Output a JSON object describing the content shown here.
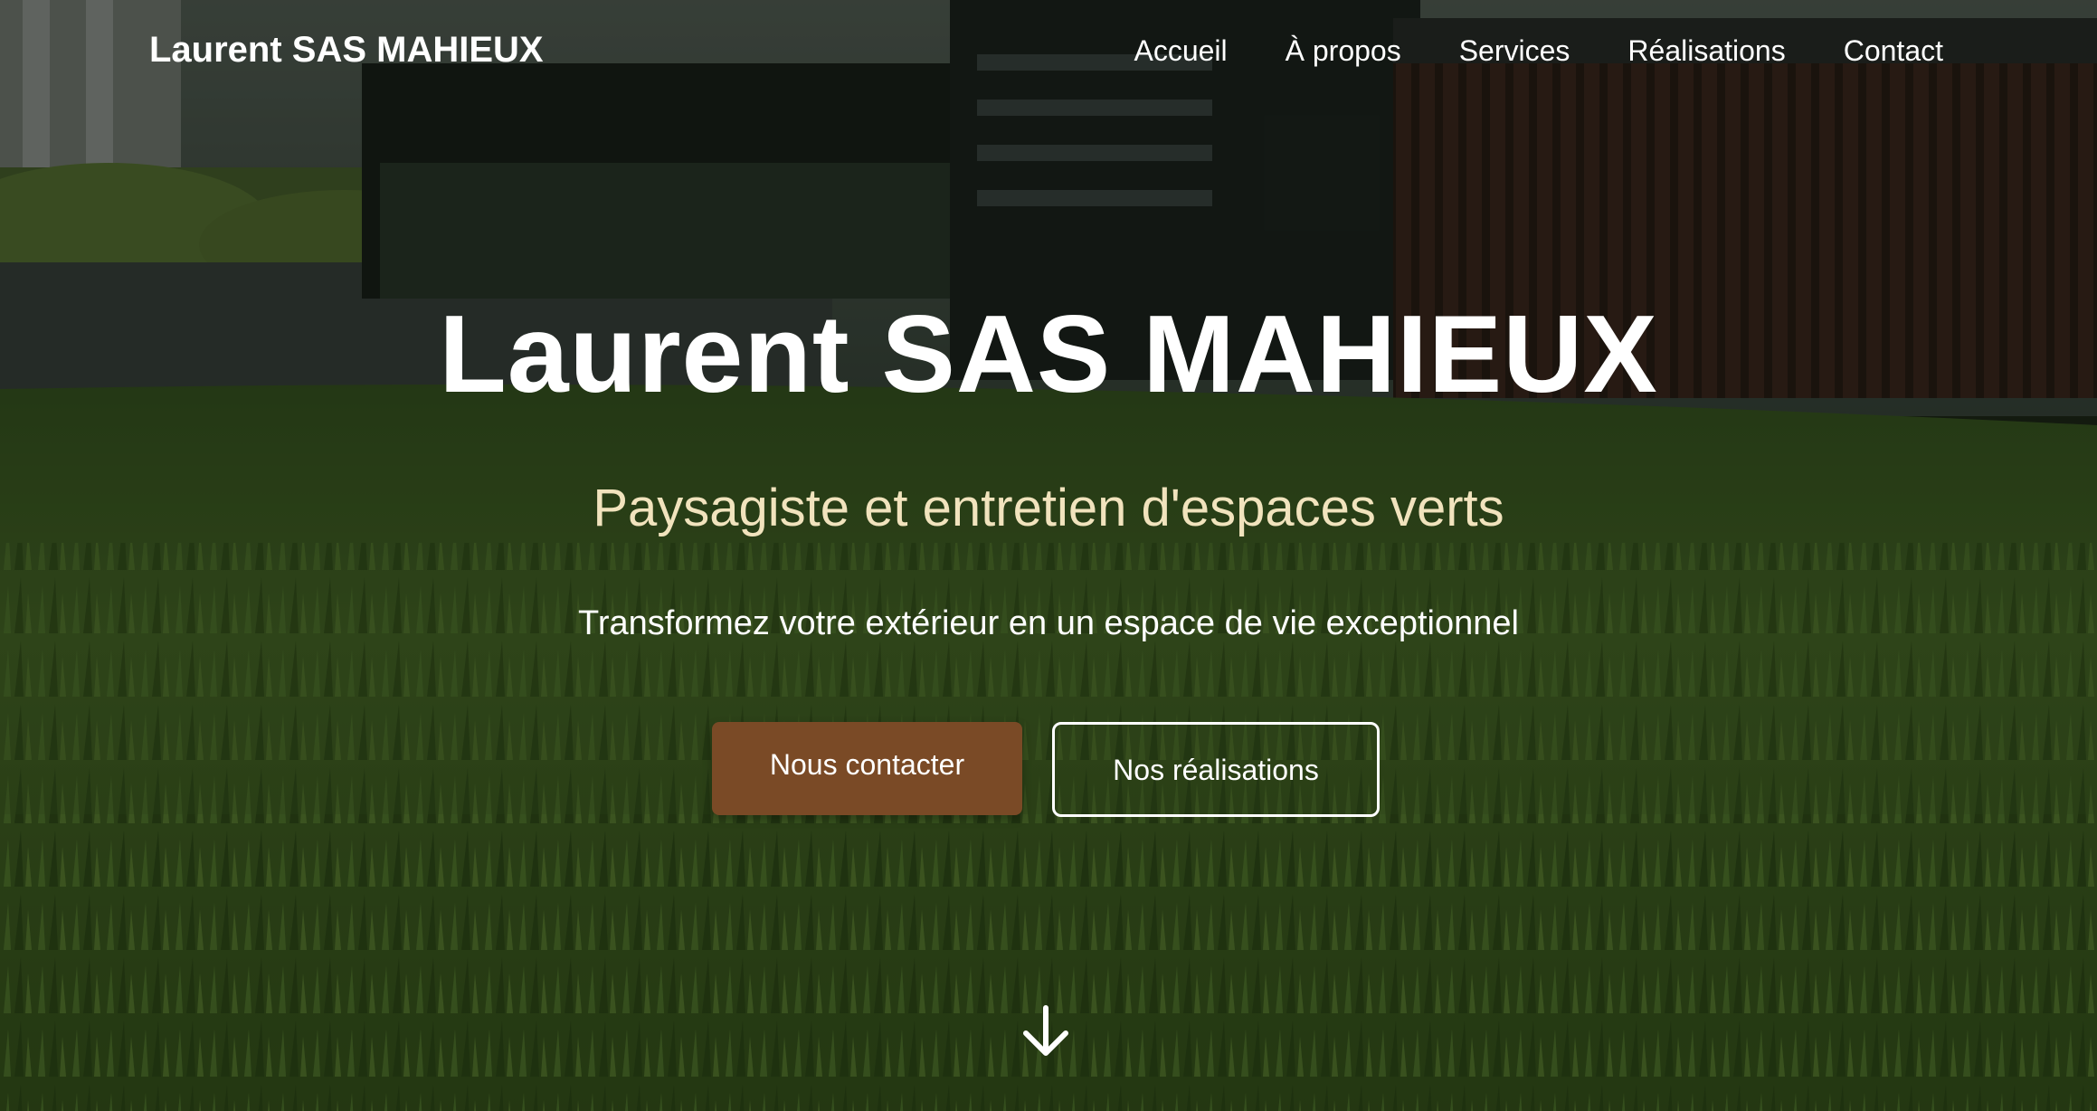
{
  "nav": {
    "brand": "Laurent SAS MAHIEUX",
    "links": [
      "Accueil",
      "À propos",
      "Services",
      "Réalisations",
      "Contact"
    ]
  },
  "hero": {
    "title": "Laurent SAS MAHIEUX",
    "subtitle": "Paysagiste et entretien d'espaces verts",
    "tagline": "Transformez votre extérieur en un espace de vie exceptionnel",
    "primary_button": "Nous contacter",
    "secondary_button": "Nos réalisations",
    "scroll_icon": "arrow-down-icon"
  },
  "colors": {
    "primary_button": "#7a4a26",
    "subtitle": "#f1e3bd",
    "text": "#ffffff"
  }
}
